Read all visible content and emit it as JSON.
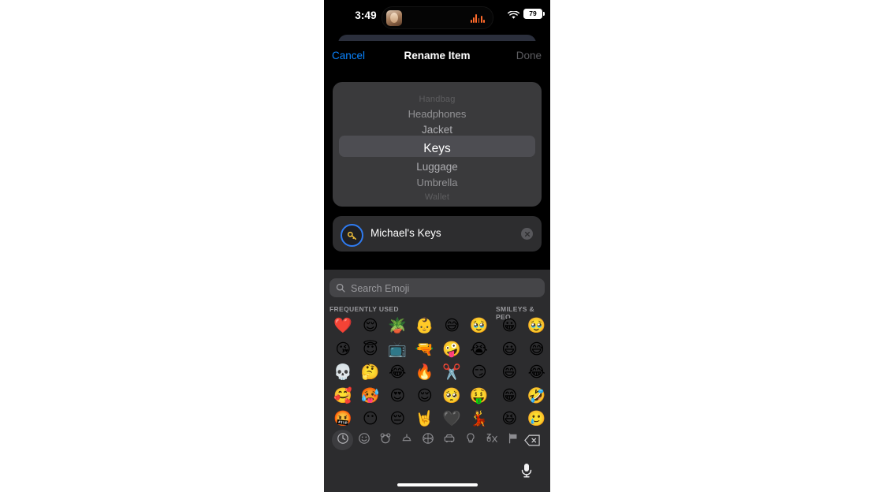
{
  "status_bar": {
    "time": "3:49",
    "battery_level": "79",
    "wifi_icon": "wifi-icon",
    "island_media_icon": "audio-waveform-icon",
    "island_avatar_icon": "album-art-avatar"
  },
  "nav_bar": {
    "cancel_label": "Cancel",
    "title": "Rename Item",
    "done_label": "Done",
    "cancel_color": "#0a84ff",
    "done_color": "#5d5d61"
  },
  "picker": {
    "items": [
      "Handbag",
      "Headphones",
      "Jacket",
      "Keys",
      "Luggage",
      "Umbrella",
      "Wallet"
    ],
    "selected_index": 3,
    "selected_value": "Keys",
    "background_color": "#3a3a3c",
    "selection_band_color": "#4d4d52"
  },
  "name_field": {
    "value": "Michael's Keys",
    "icon": "key-icon",
    "icon_color": "#f5c33b",
    "icon_ring_color": "#2f7bf0",
    "clear_icon": "clear-circle-icon"
  },
  "keyboard": {
    "search": {
      "placeholder": "Search Emoji",
      "icon": "search-icon"
    },
    "sections": [
      {
        "header": "FREQUENTLY USED"
      },
      {
        "header": "SMILEYS & PEO"
      }
    ],
    "frequently_used": [
      "❤️",
      "😌",
      "🪴",
      "👶",
      "😅",
      "🥹",
      "😘",
      "😇",
      "📺",
      "🔫",
      "🤪",
      "😭",
      "💀",
      "🤔",
      "😂",
      "🔥",
      "✂️",
      "😏",
      "🥰",
      "🥵",
      "😍",
      "😌",
      "🥺",
      "🤑",
      "🤬",
      "😶",
      "😔",
      "🤘",
      "🖤",
      "💃"
    ],
    "smileys_people": [
      "😀",
      "🥹",
      "😃",
      "😅",
      "😄",
      "😂",
      "😁",
      "🤣",
      "😆",
      "🥲"
    ],
    "categories": [
      {
        "name": "recents-category",
        "icon": "clock-icon",
        "active": true
      },
      {
        "name": "smileys-category",
        "icon": "smiley-icon",
        "active": false
      },
      {
        "name": "animals-category",
        "icon": "bear-icon",
        "active": false
      },
      {
        "name": "food-category",
        "icon": "food-icon",
        "active": false
      },
      {
        "name": "activity-category",
        "icon": "ball-icon",
        "active": false
      },
      {
        "name": "travel-category",
        "icon": "car-icon",
        "active": false
      },
      {
        "name": "objects-category",
        "icon": "lightbulb-icon",
        "active": false
      },
      {
        "name": "symbols-category",
        "icon": "symbols-icon",
        "active": false
      },
      {
        "name": "flags-category",
        "icon": "flag-icon",
        "active": false
      }
    ],
    "backspace_icon": "backspace-icon",
    "dictation_icon": "microphone-icon",
    "background_color": "#2c2c2e"
  }
}
